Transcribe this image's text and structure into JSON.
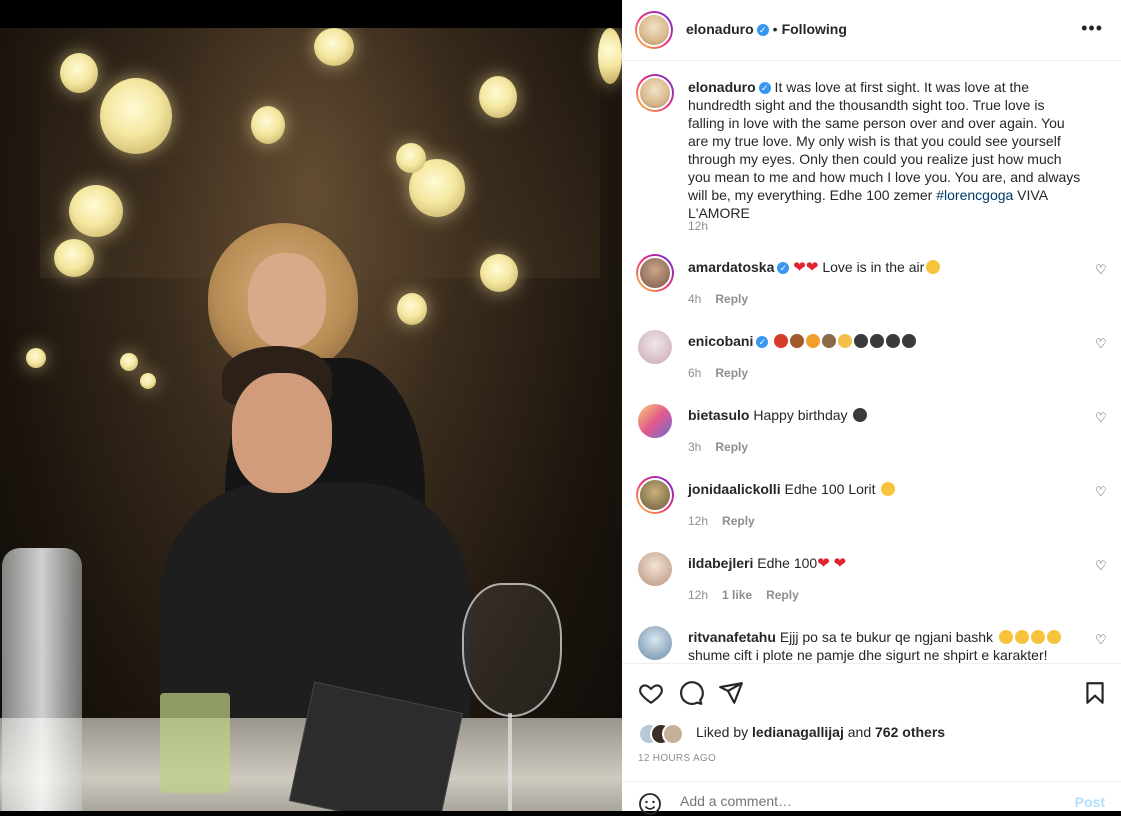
{
  "post": {
    "author": "elonaduro",
    "separator": "•",
    "follow_status": "Following",
    "more_label": "•••",
    "caption": {
      "username": "elonaduro",
      "text": " It was love at first sight. It was love at the hundredth sight and the thousandth sight too. True love is falling in love with the same person over and over again. You are my true love. My only wish is that you could see yourself through my eyes. Only then could you realize just how much you mean to me and how much I love you. You are, and always will be, my everything. Edhe 100 zemer ",
      "hashtag": "#lorencgoga",
      "suffix": " VIVA L'AMORE",
      "time": "12h"
    }
  },
  "comments": [
    {
      "user": "amardatoska",
      "verified": true,
      "text": " Love is in the air",
      "time": "4h",
      "reply": "Reply",
      "likes": ""
    },
    {
      "user": "enicobani",
      "verified": true,
      "text": "",
      "time": "6h",
      "reply": "Reply",
      "likes": ""
    },
    {
      "user": "bietasulo",
      "verified": false,
      "text": "Happy birthday",
      "time": "3h",
      "reply": "Reply",
      "likes": ""
    },
    {
      "user": "jonidaalickolli",
      "verified": false,
      "text": "Edhe 100 Lorit",
      "time": "12h",
      "reply": "Reply",
      "likes": ""
    },
    {
      "user": "ildabejleri",
      "verified": false,
      "text": "Edhe 100",
      "time": "12h",
      "reply": "Reply",
      "likes": "1 like"
    },
    {
      "user": "ritvanafetahu",
      "verified": false,
      "text": "Ejjj po sa te bukur qe ngjani bashk",
      "text2": "shume cift i plote ne pamje dhe sigurt ne shpirt e karakter!",
      "time": "",
      "reply": "",
      "likes": ""
    }
  ],
  "likes": {
    "prefix": "Liked by ",
    "user": "ledianagallijaj",
    "middle": " and ",
    "count": "762 others"
  },
  "time_ago": "12 HOURS AGO",
  "add_comment": {
    "placeholder": "Add a comment…",
    "post_label": "Post"
  }
}
